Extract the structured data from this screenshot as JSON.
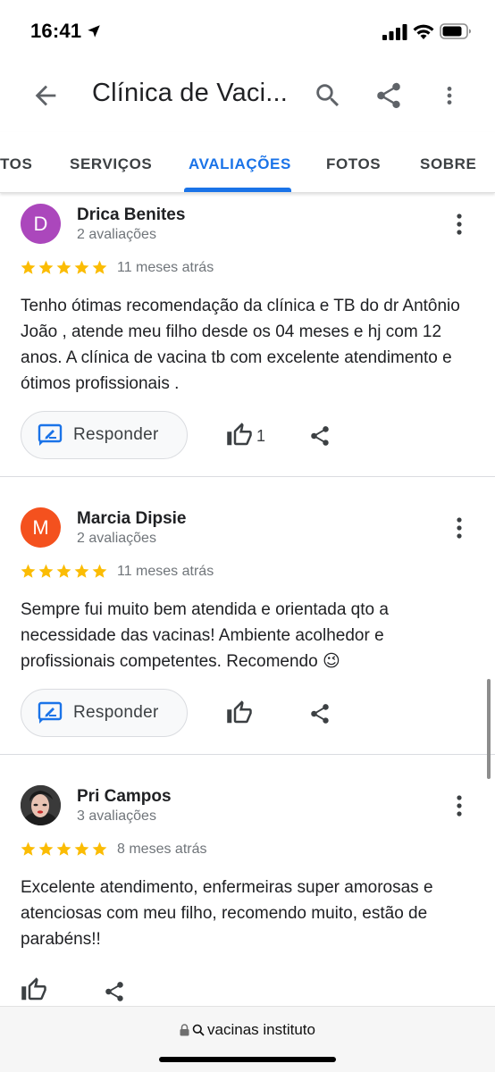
{
  "status_bar": {
    "time": "16:41"
  },
  "app_bar": {
    "title": "Clínica de Vaci..."
  },
  "tabs": [
    {
      "label": "TOS"
    },
    {
      "label": "SERVIÇOS"
    },
    {
      "label": "AVALIAÇÕES",
      "active": true
    },
    {
      "label": "FOTOS"
    },
    {
      "label": "SOBRE"
    }
  ],
  "reviews": [
    {
      "avatar_letter": "D",
      "avatar_color": "#ab47bc",
      "name": "Drica Benites",
      "count": "2 avaliações",
      "rating": 5,
      "date": "11 meses atrás",
      "text": "Tenho ótimas recomendação da clínica e TB do dr Antônio João , atende meu filho desde os 04 meses e hj com 12 anos. A clínica de vacina tb com excelente atendimento e ótimos profissionais .",
      "reply_label": "Responder",
      "likes": "1"
    },
    {
      "avatar_letter": "M",
      "avatar_color": "#f4511e",
      "name": "Marcia Dipsie",
      "count": "2 avaliações",
      "rating": 5,
      "date": "11 meses atrás",
      "text": "Sempre fui muito bem atendida e orientada qto a necessidade das vacinas! Ambiente acolhedor e profissionais competentes. Recomendo 😉",
      "reply_label": "Responder"
    },
    {
      "avatar_icon": "profile-photo",
      "name": "Pri Campos",
      "count": "3 avaliações",
      "rating": 5,
      "date": "8 meses atrás",
      "text": "Excelente atendimento, enfermeiras super amorosas e atenciosas com meu filho, recomendo muito, estão de parabéns!!"
    }
  ],
  "bottom_bar": {
    "url": "vacinas instituto"
  },
  "colors": {
    "accent": "#1a73e8",
    "star": "#fbbc04"
  }
}
